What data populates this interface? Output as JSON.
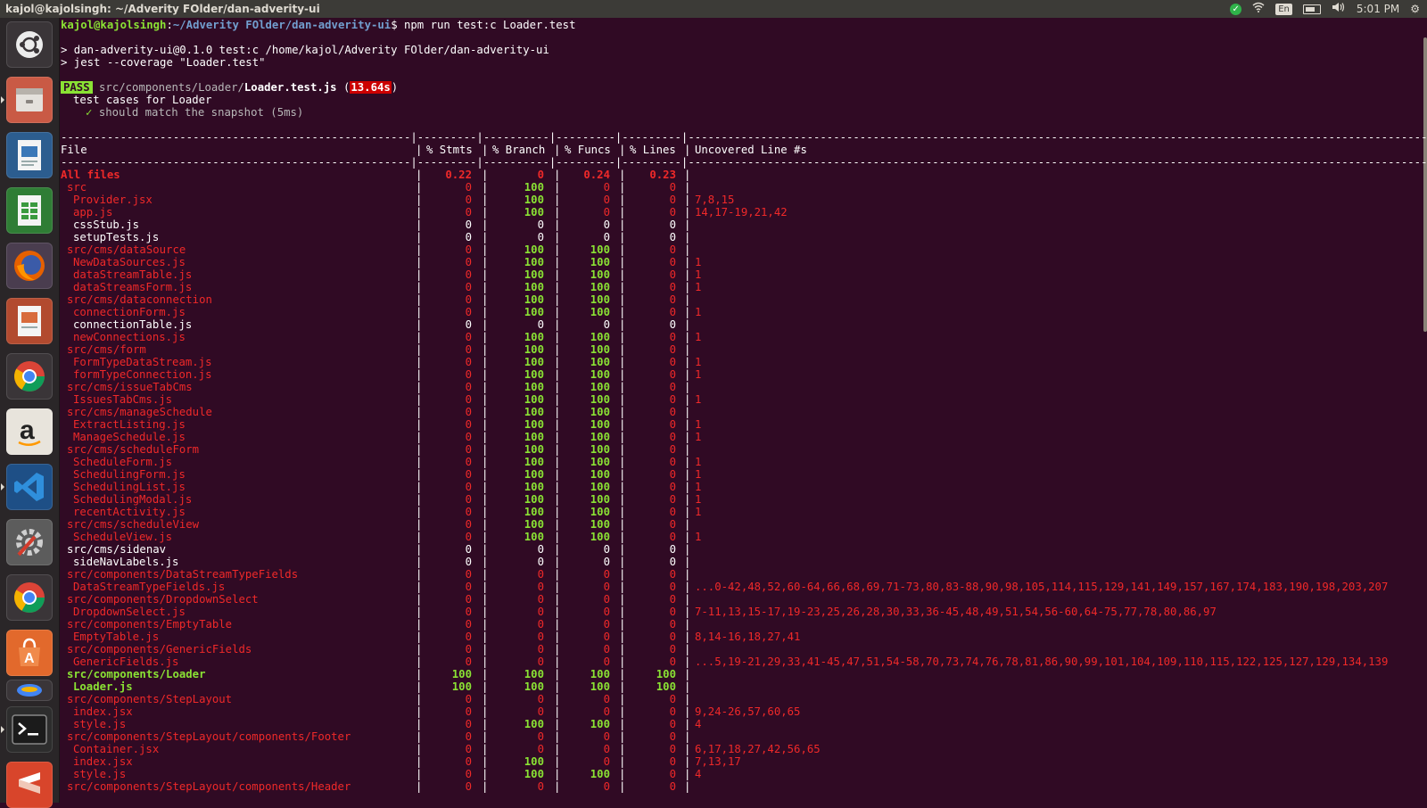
{
  "window": {
    "title": "kajol@kajolsingh: ~/Adverity FOlder/dan-adverity-ui"
  },
  "tray": {
    "check_icon": "check-circle-icon",
    "wifi_icon": "wifi-icon",
    "keyboard_layout": "En",
    "battery_icon": "battery-icon",
    "volume_icon": "volume-icon",
    "clock": "5:01 PM",
    "gear_icon": "gear-icon"
  },
  "launcher": {
    "items": [
      "ubuntu-dash-icon",
      "files-icon",
      "writer-icon",
      "calc-icon",
      "firefox-icon",
      "impress-icon",
      "chrome-icon",
      "amazon-icon",
      "vscode-icon",
      "system-settings-icon",
      "chrome-alt-icon",
      "software-center-icon",
      "drive-icon",
      "terminal-icon",
      "sublime-icon"
    ]
  },
  "terminal": {
    "prompt_user": "kajol@kajolsingh",
    "prompt_sep": ":",
    "prompt_path": "~/Adverity FOlder/dan-adverity-ui",
    "prompt_cmd": "$ npm run test:c Loader.test",
    "npm_line1": "> dan-adverity-ui@0.1.0 test:c /home/kajol/Adverity FOlder/dan-adverity-ui",
    "npm_line2": "> jest --coverage \"Loader.test\"",
    "pass_badge": "PASS",
    "test_path_dir": "src/components/Loader/",
    "test_path_file": "Loader.test.js",
    "test_duration_open": " (",
    "test_duration": "13.64s",
    "test_duration_close": ")",
    "suite_name": "test cases for Loader",
    "test_tick": "✓",
    "test_name": "should match the snapshot (5ms)",
    "separator": "-----------------------------------------------------|---------|----------|---------|---------|-------------------------------------------------------------------------------------------------------------------------------------",
    "headers": {
      "file": "File",
      "stmts": "% Stmts",
      "branch": "% Branch",
      "funcs": "% Funcs",
      "lines": "% Lines",
      "uncovered": "Uncovered Line #s"
    }
  },
  "coverage_rows": [
    {
      "file": "All files",
      "indent": 0,
      "color": "rb",
      "st": "0.22",
      "br": "0",
      "fn": "0.24",
      "ln": "0.23",
      "un": ""
    },
    {
      "file": "src",
      "indent": 1,
      "color": "red",
      "st": "0",
      "br": "100",
      "fn": "0",
      "ln": "0",
      "un": ""
    },
    {
      "file": "Provider.jsx",
      "indent": 2,
      "color": "red",
      "st": "0",
      "br": "100",
      "fn": "0",
      "ln": "0",
      "un": "7,8,15"
    },
    {
      "file": "app.js",
      "indent": 2,
      "color": "red",
      "st": "0",
      "br": "100",
      "fn": "0",
      "ln": "0",
      "un": "14,17-19,21,42"
    },
    {
      "file": "cssStub.js",
      "indent": 2,
      "color": "white",
      "st": "0",
      "br": "0",
      "fn": "0",
      "ln": "0",
      "un": ""
    },
    {
      "file": "setupTests.js",
      "indent": 2,
      "color": "white",
      "st": "0",
      "br": "0",
      "fn": "0",
      "ln": "0",
      "un": ""
    },
    {
      "file": "src/cms/dataSource",
      "indent": 1,
      "color": "red",
      "st": "0",
      "br": "100",
      "fn": "100",
      "ln": "0",
      "un": ""
    },
    {
      "file": "NewDataSources.js",
      "indent": 2,
      "color": "red",
      "st": "0",
      "br": "100",
      "fn": "100",
      "ln": "0",
      "un": "1"
    },
    {
      "file": "dataStreamTable.js",
      "indent": 2,
      "color": "red",
      "st": "0",
      "br": "100",
      "fn": "100",
      "ln": "0",
      "un": "1"
    },
    {
      "file": "dataStreamsForm.js",
      "indent": 2,
      "color": "red",
      "st": "0",
      "br": "100",
      "fn": "100",
      "ln": "0",
      "un": "1"
    },
    {
      "file": "src/cms/dataconnection",
      "indent": 1,
      "color": "red",
      "st": "0",
      "br": "100",
      "fn": "100",
      "ln": "0",
      "un": ""
    },
    {
      "file": "connectionForm.js",
      "indent": 2,
      "color": "red",
      "st": "0",
      "br": "100",
      "fn": "100",
      "ln": "0",
      "un": "1"
    },
    {
      "file": "connectionTable.js",
      "indent": 2,
      "color": "white",
      "st": "0",
      "br": "0",
      "fn": "0",
      "ln": "0",
      "un": ""
    },
    {
      "file": "newConnections.js",
      "indent": 2,
      "color": "red",
      "st": "0",
      "br": "100",
      "fn": "100",
      "ln": "0",
      "un": "1"
    },
    {
      "file": "src/cms/form",
      "indent": 1,
      "color": "red",
      "st": "0",
      "br": "100",
      "fn": "100",
      "ln": "0",
      "un": ""
    },
    {
      "file": "FormTypeDataStream.js",
      "indent": 2,
      "color": "red",
      "st": "0",
      "br": "100",
      "fn": "100",
      "ln": "0",
      "un": "1"
    },
    {
      "file": "formTypeConnection.js",
      "indent": 2,
      "color": "red",
      "st": "0",
      "br": "100",
      "fn": "100",
      "ln": "0",
      "un": "1"
    },
    {
      "file": "src/cms/issueTabCms",
      "indent": 1,
      "color": "red",
      "st": "0",
      "br": "100",
      "fn": "100",
      "ln": "0",
      "un": ""
    },
    {
      "file": "IssuesTabCms.js",
      "indent": 2,
      "color": "red",
      "st": "0",
      "br": "100",
      "fn": "100",
      "ln": "0",
      "un": "1"
    },
    {
      "file": "src/cms/manageSchedule",
      "indent": 1,
      "color": "red",
      "st": "0",
      "br": "100",
      "fn": "100",
      "ln": "0",
      "un": ""
    },
    {
      "file": "ExtractListing.js",
      "indent": 2,
      "color": "red",
      "st": "0",
      "br": "100",
      "fn": "100",
      "ln": "0",
      "un": "1"
    },
    {
      "file": "ManageSchedule.js",
      "indent": 2,
      "color": "red",
      "st": "0",
      "br": "100",
      "fn": "100",
      "ln": "0",
      "un": "1"
    },
    {
      "file": "src/cms/scheduleForm",
      "indent": 1,
      "color": "red",
      "st": "0",
      "br": "100",
      "fn": "100",
      "ln": "0",
      "un": ""
    },
    {
      "file": "ScheduleForm.js",
      "indent": 2,
      "color": "red",
      "st": "0",
      "br": "100",
      "fn": "100",
      "ln": "0",
      "un": "1"
    },
    {
      "file": "SchedulingForm.js",
      "indent": 2,
      "color": "red",
      "st": "0",
      "br": "100",
      "fn": "100",
      "ln": "0",
      "un": "1"
    },
    {
      "file": "SchedulingList.js",
      "indent": 2,
      "color": "red",
      "st": "0",
      "br": "100",
      "fn": "100",
      "ln": "0",
      "un": "1"
    },
    {
      "file": "SchedulingModal.js",
      "indent": 2,
      "color": "red",
      "st": "0",
      "br": "100",
      "fn": "100",
      "ln": "0",
      "un": "1"
    },
    {
      "file": "recentActivity.js",
      "indent": 2,
      "color": "red",
      "st": "0",
      "br": "100",
      "fn": "100",
      "ln": "0",
      "un": "1"
    },
    {
      "file": "src/cms/scheduleView",
      "indent": 1,
      "color": "red",
      "st": "0",
      "br": "100",
      "fn": "100",
      "ln": "0",
      "un": ""
    },
    {
      "file": "ScheduleView.js",
      "indent": 2,
      "color": "red",
      "st": "0",
      "br": "100",
      "fn": "100",
      "ln": "0",
      "un": "1"
    },
    {
      "file": "src/cms/sidenav",
      "indent": 1,
      "color": "white",
      "st": "0",
      "br": "0",
      "fn": "0",
      "ln": "0",
      "un": ""
    },
    {
      "file": "sideNavLabels.js",
      "indent": 2,
      "color": "white",
      "st": "0",
      "br": "0",
      "fn": "0",
      "ln": "0",
      "un": ""
    },
    {
      "file": "src/components/DataStreamTypeFields",
      "indent": 1,
      "color": "red",
      "st": "0",
      "br": "0",
      "fn": "0",
      "ln": "0",
      "un": ""
    },
    {
      "file": "DataStreamTypeFields.js",
      "indent": 2,
      "color": "red",
      "st": "0",
      "br": "0",
      "fn": "0",
      "ln": "0",
      "un": "...0-42,48,52,60-64,66,68,69,71-73,80,83-88,90,98,105,114,115,129,141,149,157,167,174,183,190,198,203,207"
    },
    {
      "file": "src/components/DropdownSelect",
      "indent": 1,
      "color": "red",
      "st": "0",
      "br": "0",
      "fn": "0",
      "ln": "0",
      "un": ""
    },
    {
      "file": "DropdownSelect.js",
      "indent": 2,
      "color": "red",
      "st": "0",
      "br": "0",
      "fn": "0",
      "ln": "0",
      "un": "7-11,13,15-17,19-23,25,26,28,30,33,36-45,48,49,51,54,56-60,64-75,77,78,80,86,97"
    },
    {
      "file": "src/components/EmptyTable",
      "indent": 1,
      "color": "red",
      "st": "0",
      "br": "0",
      "fn": "0",
      "ln": "0",
      "un": ""
    },
    {
      "file": "EmptyTable.js",
      "indent": 2,
      "color": "red",
      "st": "0",
      "br": "0",
      "fn": "0",
      "ln": "0",
      "un": "8,14-16,18,27,41"
    },
    {
      "file": "src/components/GenericFields",
      "indent": 1,
      "color": "red",
      "st": "0",
      "br": "0",
      "fn": "0",
      "ln": "0",
      "un": ""
    },
    {
      "file": "GenericFields.js",
      "indent": 2,
      "color": "red",
      "st": "0",
      "br": "0",
      "fn": "0",
      "ln": "0",
      "un": "...5,19-21,29,33,41-45,47,51,54-58,70,73,74,76,78,81,86,90,99,101,104,109,110,115,122,125,127,129,134,139"
    },
    {
      "file": "src/components/Loader",
      "indent": 1,
      "color": "green",
      "st": "100",
      "br": "100",
      "fn": "100",
      "ln": "100",
      "un": ""
    },
    {
      "file": "Loader.js",
      "indent": 2,
      "color": "green",
      "st": "100",
      "br": "100",
      "fn": "100",
      "ln": "100",
      "un": ""
    },
    {
      "file": "src/components/StepLayout",
      "indent": 1,
      "color": "red",
      "st": "0",
      "br": "0",
      "fn": "0",
      "ln": "0",
      "un": ""
    },
    {
      "file": "index.jsx",
      "indent": 2,
      "color": "red",
      "st": "0",
      "br": "0",
      "fn": "0",
      "ln": "0",
      "un": "9,24-26,57,60,65"
    },
    {
      "file": "style.js",
      "indent": 2,
      "color": "red",
      "st": "0",
      "br": "100",
      "fn": "100",
      "ln": "0",
      "un": "4"
    },
    {
      "file": "src/components/StepLayout/components/Footer",
      "indent": 1,
      "color": "red",
      "st": "0",
      "br": "0",
      "fn": "0",
      "ln": "0",
      "un": ""
    },
    {
      "file": "Container.jsx",
      "indent": 2,
      "color": "red",
      "st": "0",
      "br": "0",
      "fn": "0",
      "ln": "0",
      "un": "6,17,18,27,42,56,65"
    },
    {
      "file": "index.jsx",
      "indent": 2,
      "color": "red",
      "st": "0",
      "br": "100",
      "fn": "0",
      "ln": "0",
      "un": "7,13,17"
    },
    {
      "file": "style.js",
      "indent": 2,
      "color": "red",
      "st": "0",
      "br": "100",
      "fn": "100",
      "ln": "0",
      "un": "4"
    },
    {
      "file": "src/components/StepLayout/components/Header",
      "indent": 1,
      "color": "red",
      "st": "0",
      "br": "0",
      "fn": "0",
      "ln": "0",
      "un": ""
    }
  ]
}
